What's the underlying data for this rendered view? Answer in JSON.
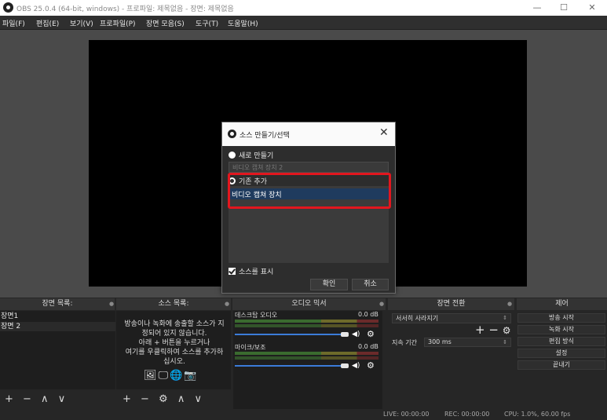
{
  "window": {
    "title": "OBS 25.0.4 (64-bit, windows) - 프로파일: 제목없음 - 장면: 제목없음",
    "minimize": "—",
    "maximize": "☐",
    "close": "✕"
  },
  "menu": [
    "파일(F)",
    "편집(E)",
    "보기(V)",
    "프로파일(P)",
    "장면 모음(S)",
    "도구(T)",
    "도움말(H)"
  ],
  "dialog": {
    "title": "소스 만들기/선택",
    "close": "✕",
    "create_new_label": "새로 만들기",
    "name_value": "비디오 캡쳐 장치 2",
    "add_existing_label": "기존 추가",
    "existing_items": [
      "비디오 캡쳐 장치"
    ],
    "make_visible_label": "소스를 표시",
    "make_visible_checked": true,
    "ok_label": "확인",
    "cancel_label": "취소",
    "highlight_color": "#e2161e"
  },
  "scenes": {
    "title": "장면 목록:",
    "items": [
      "장면1",
      "장면 2"
    ],
    "toolbar": "+ − ∧ ∨"
  },
  "sources": {
    "title": "소스 목록:",
    "empty_lines": [
      "방송이나 녹화에 송출할 소스가 지",
      "정되어 있지 않습니다.",
      "아래 + 버튼을 누르거나",
      "여기를 우클릭하여 소스를 추가하",
      "십시오."
    ],
    "icons": [
      "image-icon",
      "display-capture-icon",
      "browser-icon",
      "camera-icon"
    ],
    "toolbar": "+ − ⚙ ∧ ∨"
  },
  "mixer": {
    "title": "오디오 믹서",
    "channels": [
      {
        "name": "데스크탑 오디오",
        "db": "0.0 dB"
      },
      {
        "name": "마이크/보조",
        "db": "0.0 dB"
      }
    ]
  },
  "transitions": {
    "title": "장면 전환",
    "selected": "서서히 사라지기",
    "duration_label": "지속 기간",
    "duration_value": "300 ms",
    "add_remove": "+ −"
  },
  "controls": {
    "title": "제어",
    "buttons": [
      "방송 시작",
      "녹화 시작",
      "편집 방식",
      "설정",
      "끝내기"
    ]
  },
  "status": {
    "live": "LIVE: 00:00:00",
    "rec": "REC: 00:00:00",
    "cpu": "CPU: 1.0%, 60.00 fps"
  }
}
